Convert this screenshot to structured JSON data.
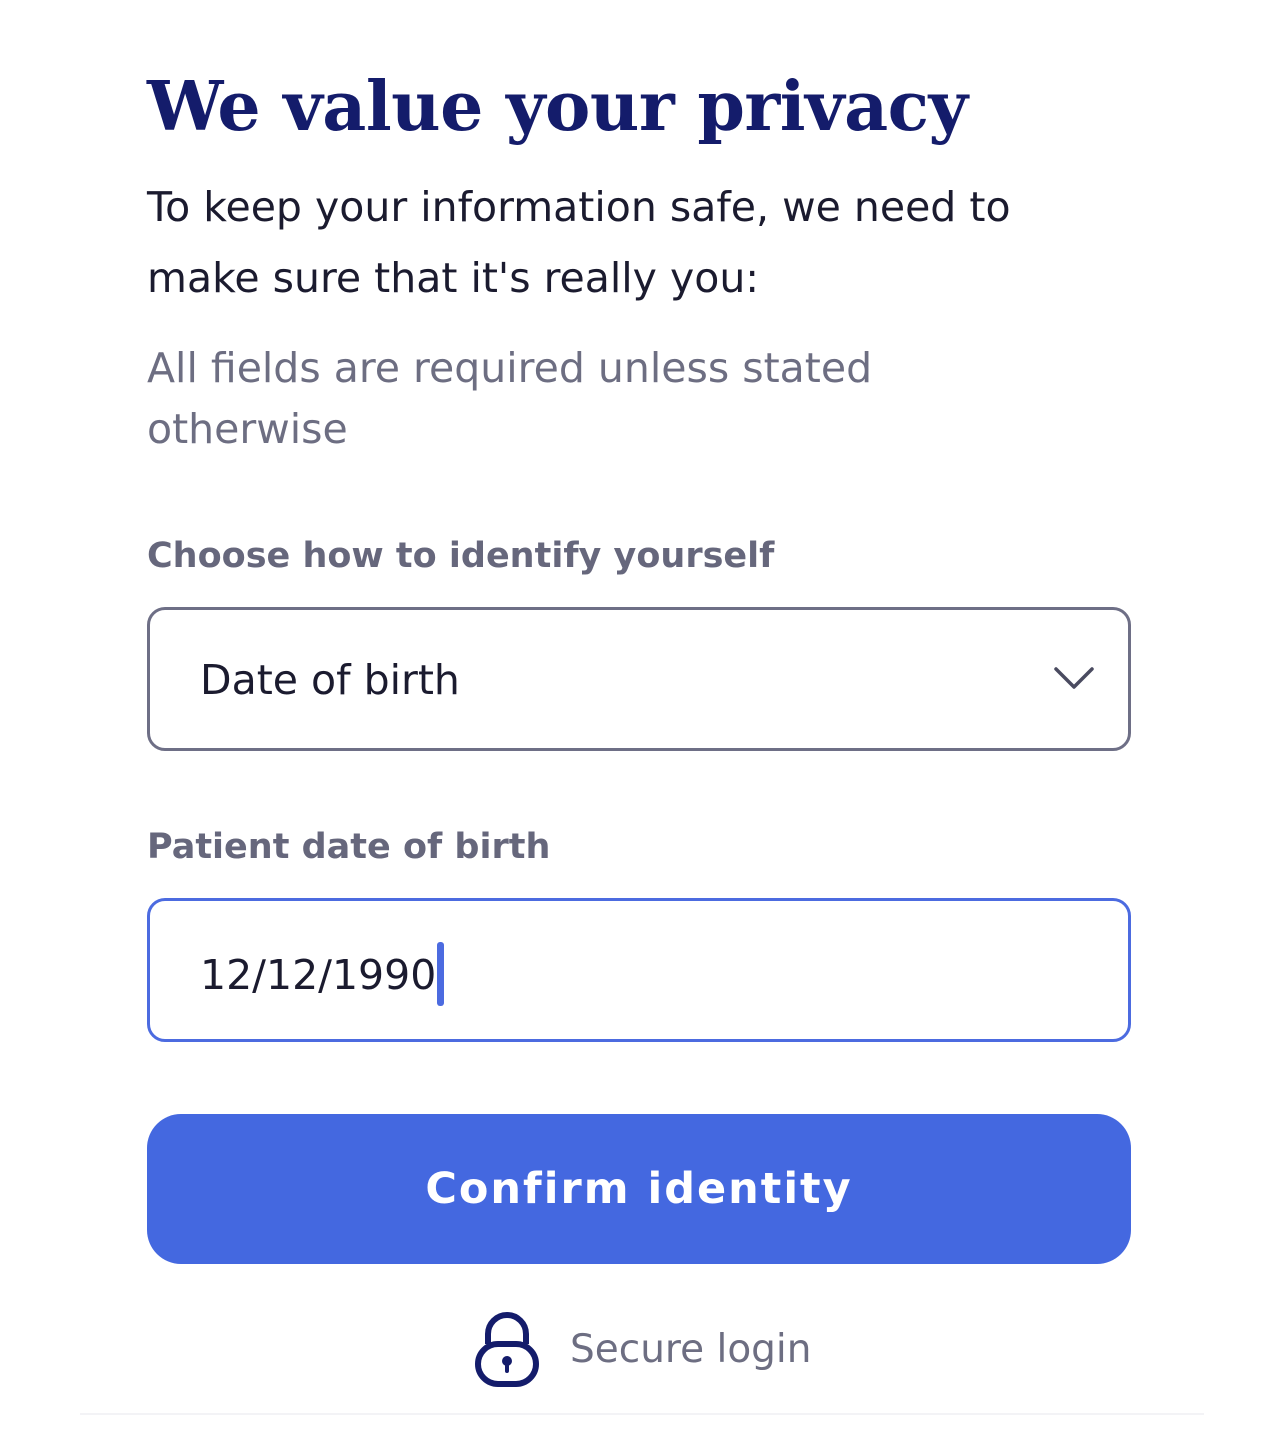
{
  "page": {
    "title": "We value your privacy",
    "intro": "To keep your information safe, we need to make sure that it's really you:",
    "required_note": "All fields are required unless stated otherwise"
  },
  "identify": {
    "label": "Choose how to identify yourself",
    "selected": "Date of birth",
    "icon": "chevron-down-icon"
  },
  "dob": {
    "label": "Patient date of birth",
    "value": "12/12/1990"
  },
  "actions": {
    "confirm_label": "Confirm identity"
  },
  "footer": {
    "secure_text": "Secure login",
    "icon": "lock-icon"
  },
  "colors": {
    "title": "#141c6b",
    "primary": "#4468e0",
    "focus_border": "#4c6be0",
    "muted_text": "#6d6e82"
  }
}
